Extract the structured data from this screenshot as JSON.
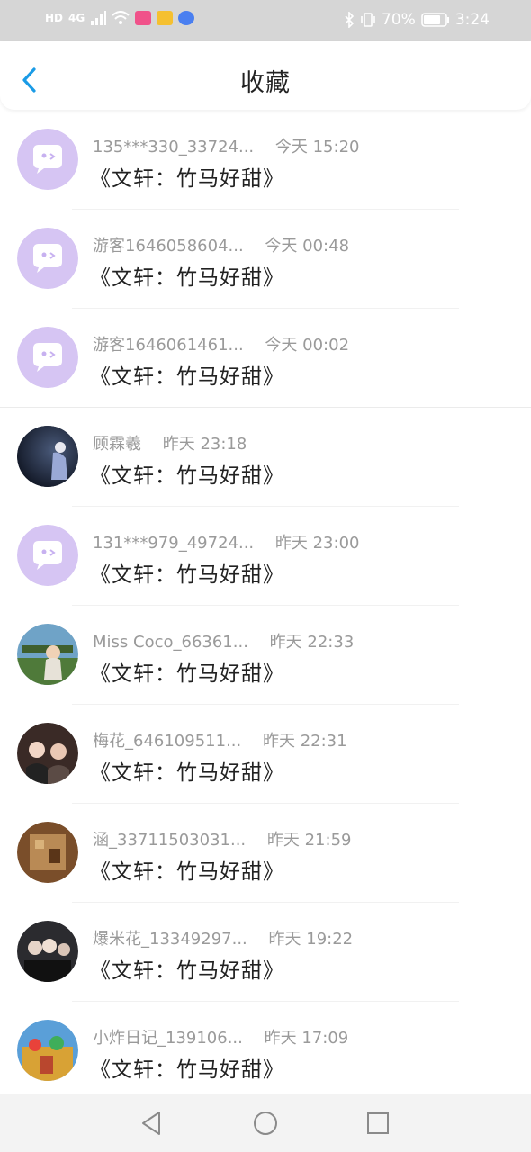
{
  "status_bar": {
    "left_text": "HD",
    "network": "4G",
    "battery": "70%",
    "time": "3:24",
    "app_icon_colors": [
      "#f0528a",
      "#f5c030",
      "#4a7ff0"
    ]
  },
  "header": {
    "back_icon": "chevron-left-icon",
    "title": "收藏",
    "accent": "#1a9be6"
  },
  "items": [
    {
      "user": "135***330_33724...",
      "time": "今天 15:20",
      "work": "《文轩：竹马好甜》",
      "avatar": "default-purple"
    },
    {
      "user": "游客1646058604...",
      "time": "今天 00:48",
      "work": "《文轩：竹马好甜》",
      "avatar": "default-purple"
    },
    {
      "user": "游客1646061461...",
      "time": "今天 00:02",
      "work": "《文轩：竹马好甜》",
      "avatar": "default-purple"
    },
    {
      "user": "顾霖羲",
      "time": "昨天 23:18",
      "work": "《文轩：竹马好甜》",
      "avatar": "photo-dark"
    },
    {
      "user": "131***979_49724...",
      "time": "昨天 23:00",
      "work": "《文轩：竹马好甜》",
      "avatar": "default-purple"
    },
    {
      "user": "Miss Coco_66361...",
      "time": "昨天 22:33",
      "work": "《文轩：竹马好甜》",
      "avatar": "photo-outdoor"
    },
    {
      "user": "梅花_646109511...",
      "time": "昨天 22:31",
      "work": "《文轩：竹马好甜》",
      "avatar": "photo-group"
    },
    {
      "user": "涵_33711503031...",
      "time": "昨天 21:59",
      "work": "《文轩：竹马好甜》",
      "avatar": "photo-warm"
    },
    {
      "user": "爆米花_13349297...",
      "time": "昨天 19:22",
      "work": "《文轩：竹马好甜》",
      "avatar": "photo-boys"
    },
    {
      "user": "小炸日记_139106...",
      "time": "昨天 17:09",
      "work": "《文轩：竹马好甜》",
      "avatar": "photo-colorful"
    }
  ],
  "nav": {
    "back": "triangle-back-icon",
    "home": "circle-home-icon",
    "recents": "square-recents-icon"
  }
}
